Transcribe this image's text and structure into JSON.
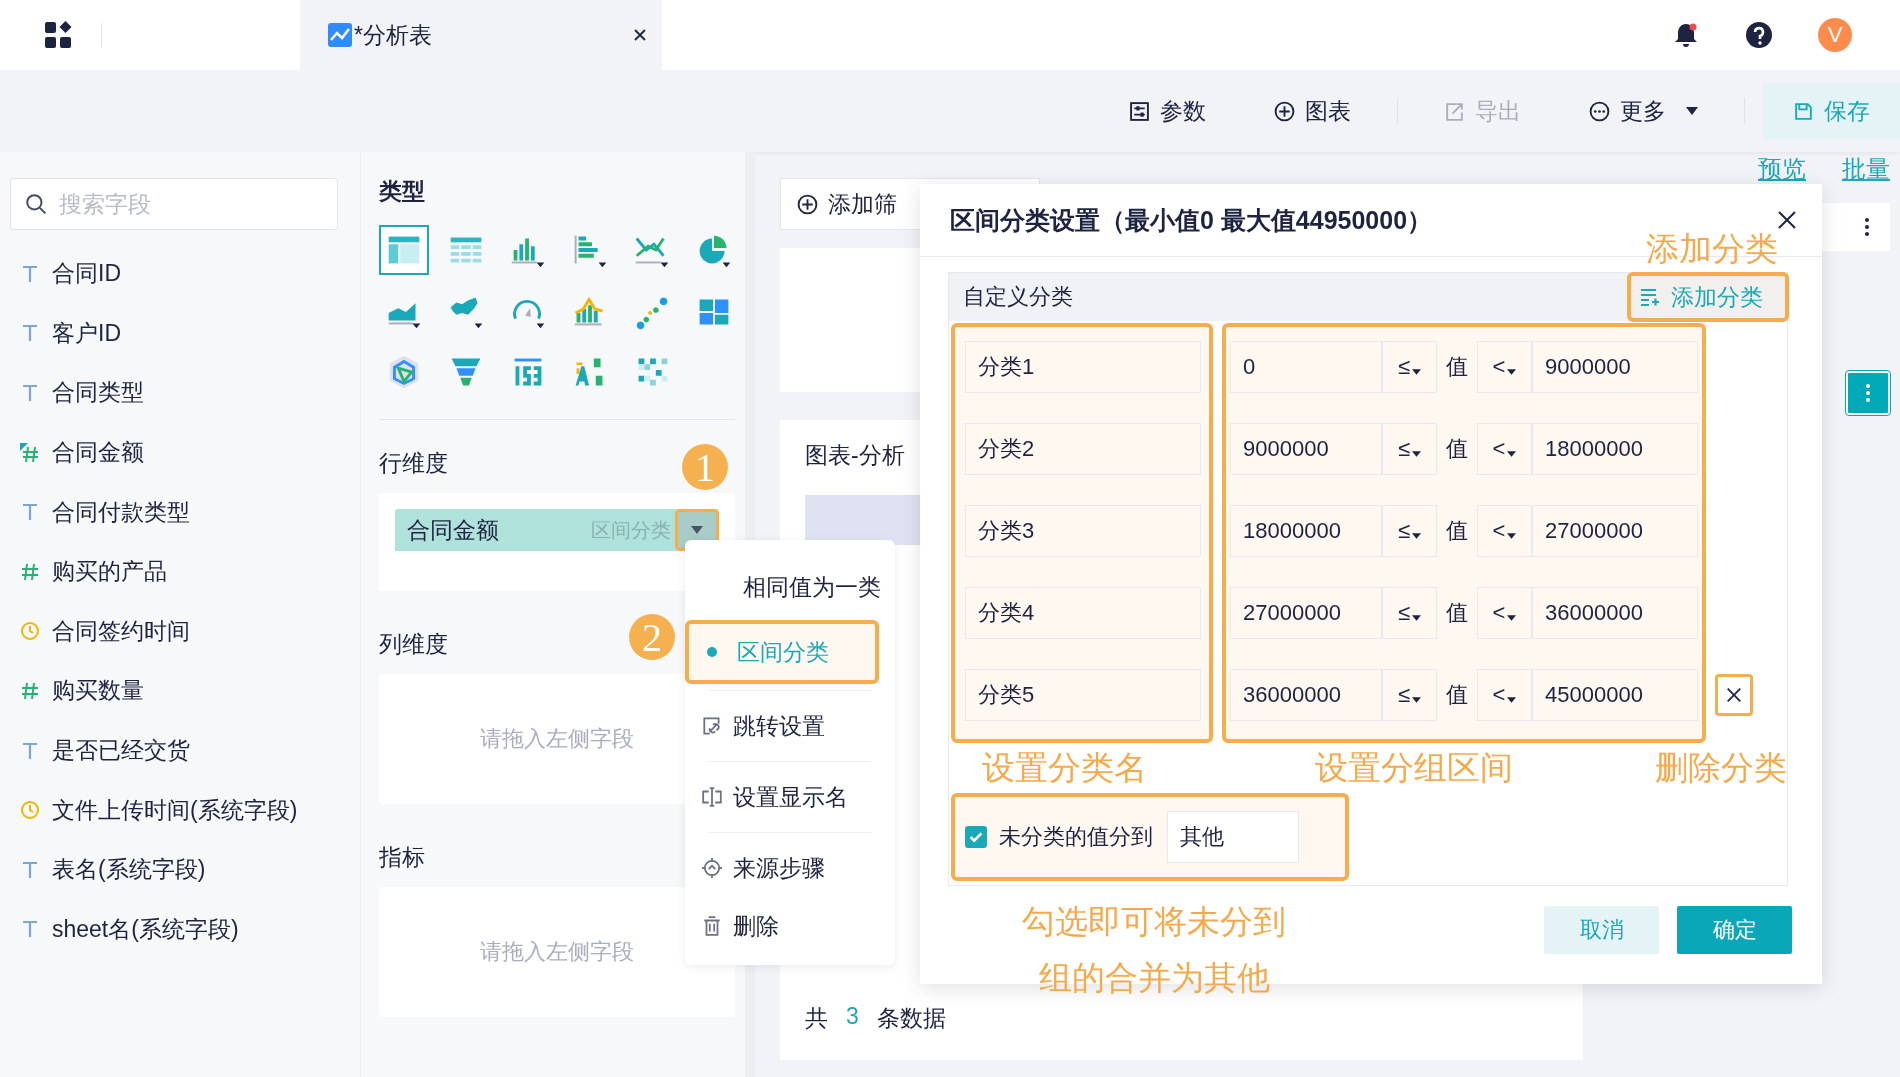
{
  "topbar": {
    "tab": {
      "title": "*分析表",
      "selected": true
    },
    "avatar": "V"
  },
  "toolbar": [
    {
      "label": "参数",
      "disabled": false,
      "kind": "plain"
    },
    {
      "label": "图表",
      "disabled": false,
      "kind": "plain"
    },
    {
      "label": "导出",
      "disabled": true,
      "kind": "plain"
    },
    {
      "label": "更多",
      "disabled": false,
      "kind": "dropdown"
    },
    {
      "label": "保存",
      "disabled": false,
      "kind": "save"
    }
  ],
  "fields": {
    "placeholder": "搜索字段",
    "items": [
      {
        "label": "合同ID",
        "kind": "text"
      },
      {
        "label": "客户ID",
        "kind": "text"
      },
      {
        "label": "合同类型",
        "kind": "text"
      },
      {
        "label": "合同金额",
        "kind": "converted"
      },
      {
        "label": "合同付款类型",
        "kind": "text"
      },
      {
        "label": "购买的产品",
        "kind": "number"
      },
      {
        "label": "合同签约时间",
        "kind": "date"
      },
      {
        "label": "购买数量",
        "kind": "number"
      },
      {
        "label": "是否已经交货",
        "kind": "text"
      },
      {
        "label": "文件上传时间(系统字段)",
        "kind": "date"
      },
      {
        "label": "表名(系统字段)",
        "kind": "text"
      },
      {
        "label": "sheet名(系统字段)",
        "kind": "text"
      }
    ]
  },
  "config": {
    "type_title": "类型",
    "chart_types": [
      {
        "selected": true
      },
      {
        "selected": false
      },
      {
        "selected": false
      },
      {
        "selected": false
      },
      {
        "selected": false
      },
      {
        "selected": false
      },
      {
        "selected": false
      },
      {
        "selected": false
      },
      {
        "selected": false
      },
      {
        "selected": false
      },
      {
        "selected": false
      },
      {
        "selected": false
      },
      {
        "selected": false
      },
      {
        "selected": false
      },
      {
        "selected": false
      },
      {
        "selected": false
      },
      {
        "selected": false
      }
    ],
    "row_dim": {
      "title": "行维度",
      "pill": {
        "label": "合同金额",
        "tag": "区间分类"
      }
    },
    "col_dim": {
      "title": "列维度",
      "placeholder": "请拖入左侧字段"
    },
    "measure": {
      "title": "指标",
      "placeholder": "请拖入左侧字段"
    }
  },
  "menu": [
    [
      {
        "label": "相同值为一类",
        "selected": false
      },
      {
        "label": "区间分类",
        "selected": true
      }
    ],
    [
      {
        "label": "跳转设置",
        "selected": false
      }
    ],
    [
      {
        "label": "设置显示名",
        "selected": false
      }
    ],
    [
      {
        "label": "来源步骤",
        "selected": false
      },
      {
        "label": "删除",
        "selected": false
      }
    ]
  ],
  "canvas": {
    "filter_button": "添加筛",
    "chart_title": "图表-分析",
    "footer": {
      "prefix": "共",
      "count": "3",
      "suffix": "条数据"
    }
  },
  "right_panel": {
    "links": [
      "预览",
      "批量"
    ]
  },
  "dialog": {
    "title": "区间分类设置（最小值0 最大值44950000）",
    "section": "自定义分类",
    "add_button": "添加分类",
    "rows": [
      {
        "name": "分类1",
        "lower": "0",
        "lower_op": "≤",
        "value_label": "值",
        "upper_op": "<",
        "upper": "9000000",
        "deletable": false
      },
      {
        "name": "分类2",
        "lower": "9000000",
        "lower_op": "≤",
        "value_label": "值",
        "upper_op": "<",
        "upper": "18000000",
        "deletable": false
      },
      {
        "name": "分类3",
        "lower": "18000000",
        "lower_op": "≤",
        "value_label": "值",
        "upper_op": "<",
        "upper": "27000000",
        "deletable": false
      },
      {
        "name": "分类4",
        "lower": "27000000",
        "lower_op": "≤",
        "value_label": "值",
        "upper_op": "<",
        "upper": "36000000",
        "deletable": false
      },
      {
        "name": "分类5",
        "lower": "36000000",
        "lower_op": "≤",
        "value_label": "值",
        "upper_op": "<",
        "upper": "45000000",
        "deletable": true
      }
    ],
    "other": {
      "checked": true,
      "label": "未分类的值分到",
      "value": "其他"
    },
    "cancel": "取消",
    "ok": "确定"
  },
  "annotations": {
    "add": "添加分类",
    "name": "设置分类名",
    "range": "设置分组区间",
    "delete": "删除分类",
    "other_lines": [
      "勾选即可将未分到",
      "组的合并为其他"
    ],
    "badges": [
      "1",
      "2"
    ]
  }
}
